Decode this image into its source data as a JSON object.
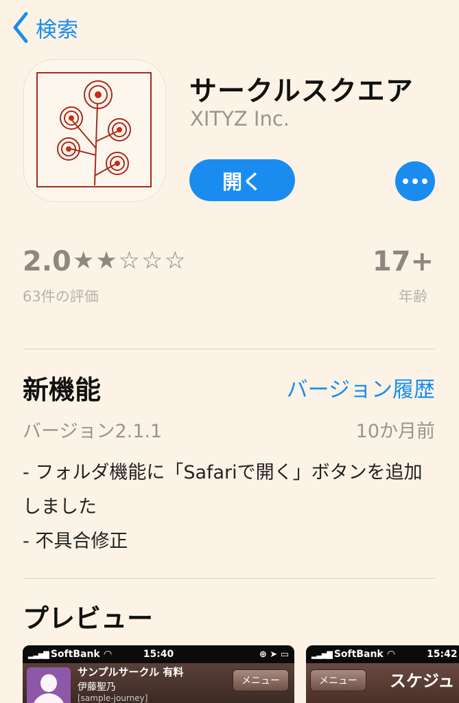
{
  "nav": {
    "back_label": "検索"
  },
  "app": {
    "name": "サークルスクエア",
    "developer": "XITYZ Inc.",
    "open_label": "開く"
  },
  "ratings": {
    "value": "2.0",
    "stars": "★★☆☆☆",
    "star_count": 2,
    "star_max": 5,
    "count_label": "63件の評価",
    "age_value": "17+",
    "age_label": "年齢"
  },
  "whats_new": {
    "title": "新機能",
    "history_link": "バージョン履歴",
    "version": "バージョン2.1.1",
    "date": "10か月前",
    "notes": [
      "- フォルダ機能に「Safariで開く」ボタンを追加",
      "しました",
      "- 不具合修正"
    ]
  },
  "preview": {
    "title": "プレビュー",
    "screenshots": [
      {
        "carrier": "SoftBank",
        "time": "15:40",
        "line1": "サンプルサークル 有料",
        "line2": "伊藤聖乃",
        "line3": "[sample-journey]",
        "menu": "メニュー"
      },
      {
        "carrier": "SoftBank",
        "time": "15:42",
        "menu": "メニュー",
        "title": "スケジュ"
      }
    ]
  },
  "colors": {
    "background": "#fcf3e6",
    "accent": "#1a8cf0",
    "icon_red": "#a52a1e",
    "muted": "#8d8780"
  }
}
